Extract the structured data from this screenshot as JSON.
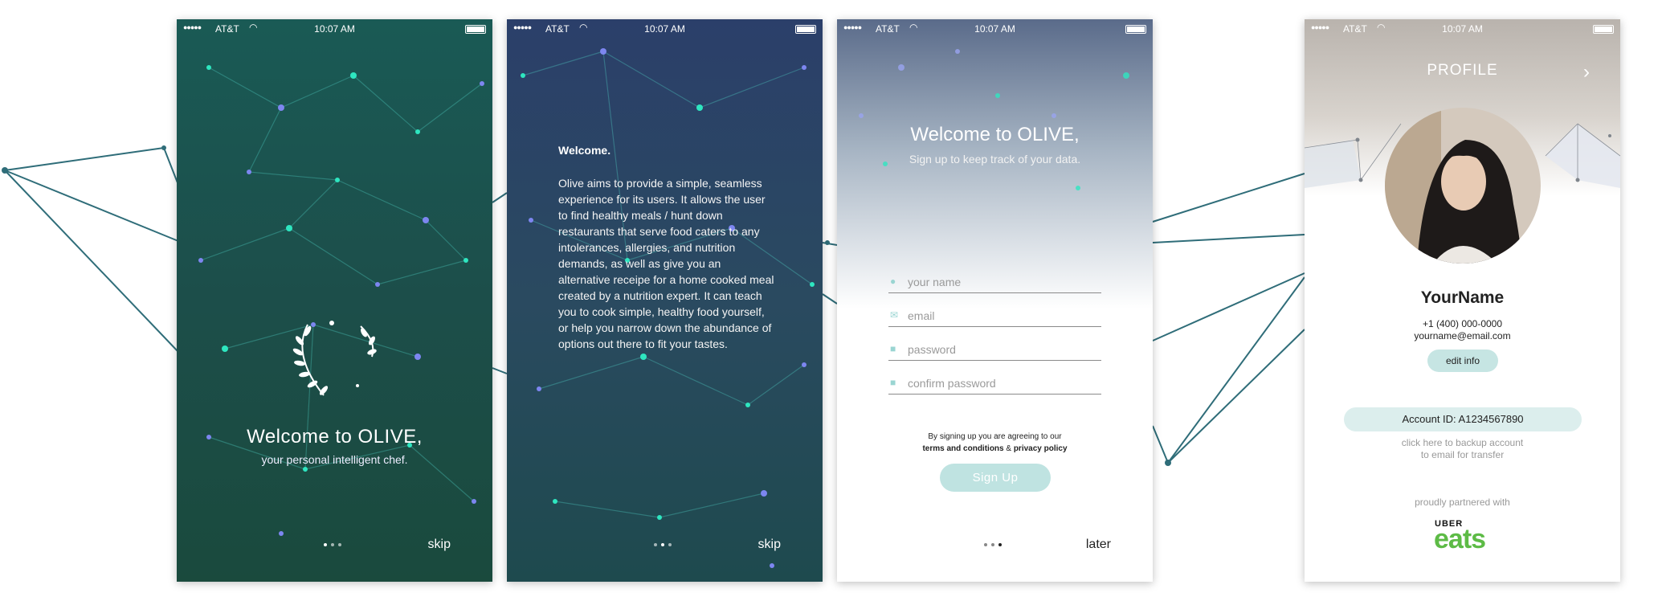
{
  "status_bar": {
    "signal": "●●●●●",
    "carrier": "AT&T",
    "time": "10:07 AM"
  },
  "screen1": {
    "title": "Welcome to OLIVE,",
    "subtitle": "your personal intelligent chef.",
    "skip": "skip",
    "page_index": 1
  },
  "screen2": {
    "heading": "Welcome.",
    "body": "Olive aims to provide a simple, seamless experience for its users. It allows the user to find healthy meals / hunt down restaurants that serve food caters to any intolerances, allergies, and nutrition demands, as well as give you an alternative receipe for a home cooked meal created by a nutrition expert. It can teach you to cook simple, healthy food yourself, or help you narrow down the abundance of options out there to fit your tastes.",
    "skip": "skip",
    "page_index": 2
  },
  "screen3": {
    "title": "Welcome to OLIVE,",
    "subtitle": "Sign up to keep track of your data.",
    "fields": [
      {
        "placeholder": "your name",
        "icon": "person-icon"
      },
      {
        "placeholder": "email",
        "icon": "mail-icon"
      },
      {
        "placeholder": "password",
        "icon": "lock-icon"
      },
      {
        "placeholder": "confirm password",
        "icon": "lock-icon"
      }
    ],
    "terms_line1": "By signing up you are agreeing to our",
    "terms_link": "terms and conditions",
    "terms_and": " & ",
    "privacy_link": "privacy policy",
    "signup_label": "Sign Up",
    "later": "later",
    "page_index": 3
  },
  "screen4": {
    "title": "PROFILE",
    "name": "YourName",
    "phone": "+1 (400) 000-0000",
    "email": "yourname@email.com",
    "edit_label": "edit info",
    "account_id": "Account ID: A1234567890",
    "backup_line1": "click here to backup account",
    "backup_line2": "to email for transfer",
    "partner_text": "proudly partnered with",
    "partner_logo_top": "UBER",
    "partner_logo_bottom": "eats"
  },
  "colors": {
    "teal_accent": "#bfe3e1",
    "network_teal": "#2ee6c0",
    "network_violet": "#7d86f0",
    "line_teal": "#2f6d79",
    "uber_green": "#5dbb46"
  }
}
